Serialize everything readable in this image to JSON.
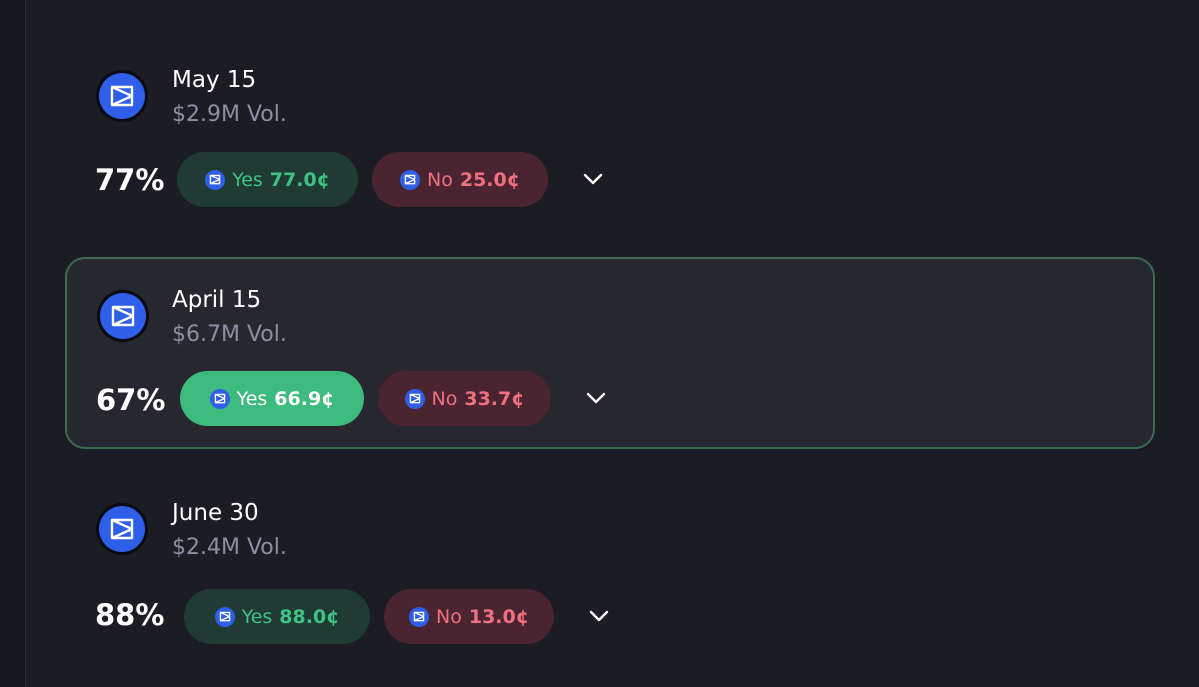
{
  "colors": {
    "background": "#1c1c25",
    "highlight_border": "#3d6a53",
    "yes_green": "#3fc384",
    "no_red": "#f0707f",
    "logo_blue": "#2f5ee8"
  },
  "markets": [
    {
      "title": "May 15",
      "volume": "$2.9M Vol.",
      "percent": "77%",
      "yes": {
        "label": "Yes",
        "price": "77.0¢"
      },
      "no": {
        "label": "No",
        "price": "25.0¢"
      },
      "selected": false,
      "icons": {
        "logo": "market-logo-icon",
        "expand": "chevron-down-icon"
      }
    },
    {
      "title": "April 15",
      "volume": "$6.7M Vol.",
      "percent": "67%",
      "yes": {
        "label": "Yes",
        "price": "66.9¢"
      },
      "no": {
        "label": "No",
        "price": "33.7¢"
      },
      "selected": true,
      "icons": {
        "logo": "market-logo-icon",
        "expand": "chevron-down-icon"
      }
    },
    {
      "title": "June 30",
      "volume": "$2.4M Vol.",
      "percent": "88%",
      "yes": {
        "label": "Yes",
        "price": "88.0¢"
      },
      "no": {
        "label": "No",
        "price": "13.0¢"
      },
      "selected": false,
      "icons": {
        "logo": "market-logo-icon",
        "expand": "chevron-down-icon"
      }
    }
  ]
}
